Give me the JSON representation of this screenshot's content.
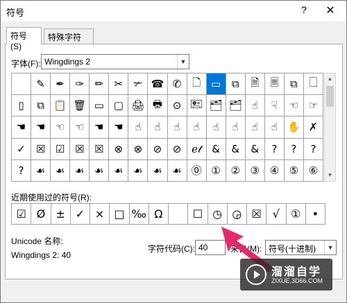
{
  "window": {
    "title": "符号",
    "help_label": "?",
    "close_label": "✕"
  },
  "tabs": [
    {
      "label": "符号(S)"
    },
    {
      "label": "特殊字符(P)"
    }
  ],
  "font": {
    "label": "字体(F):",
    "value": "Wingdings 2"
  },
  "symbol_grid": {
    "selected_index": 10,
    "rows": [
      [
        "",
        "✎",
        "✒",
        "✑",
        "✏",
        "✂",
        "✃",
        "☎",
        "✆",
        "🗋",
        "▭",
        "⧉",
        "🗎",
        "🗏",
        "⧉",
        "🗌"
      ],
      [
        "▯",
        "⧉",
        "📋",
        "🗑",
        "▭",
        "▢",
        "🖨",
        "🖶",
        "⊙",
        "🖭",
        "🗂",
        "🗂",
        "☝",
        "☟",
        "☜",
        "☞"
      ],
      [
        "☚",
        "☚",
        "☜",
        "☜",
        "☚",
        "☚",
        "☝",
        "☝",
        "☝",
        "☝",
        "☝",
        "☝",
        "☝",
        "☝",
        "✋",
        "✗"
      ],
      [
        "✓",
        "☒",
        "☑",
        "☒",
        "☒",
        "⊗",
        "⊗",
        "⊘",
        "⊘",
        "ℯ𝓉",
        "&",
        "&",
        "&",
        "?",
        "?",
        "?"
      ],
      [
        "?",
        "☙",
        "☙",
        "☙",
        "☙",
        "☙",
        "☙",
        "☙",
        "☙",
        "⓪",
        "①",
        "②",
        "③",
        "④",
        "⑤",
        "⑥"
      ]
    ]
  },
  "recent": {
    "label": "近期使用过的符号(R):",
    "symbols": [
      "☑",
      "Ø",
      "±",
      "✓",
      "×",
      "□",
      "‰",
      "Ω",
      "",
      "☐",
      "◷",
      "◶",
      "☒",
      "√",
      "①",
      "•"
    ]
  },
  "unicode": {
    "label": "Unicode 名称:",
    "name": "Wingdings 2: 40"
  },
  "char_code": {
    "label": "字符代码(C):",
    "value": "40"
  },
  "from": {
    "label": "来自(M):",
    "value": "符号(十进制)"
  },
  "watermark": {
    "title": "溜溜自学",
    "url": "ZIXUE.3D66.COM"
  }
}
